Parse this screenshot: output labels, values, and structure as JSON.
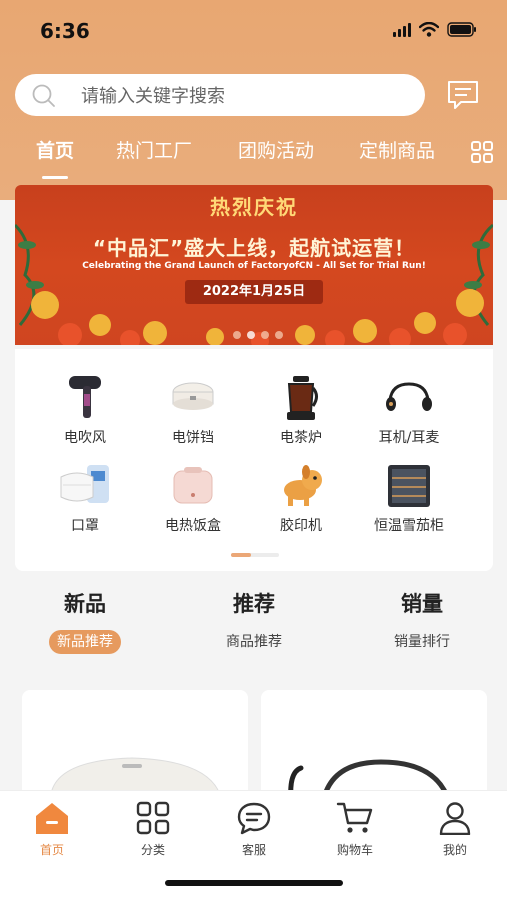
{
  "status": {
    "time": "6:36"
  },
  "search": {
    "placeholder": "请输入关键字搜索"
  },
  "tabs": [
    {
      "label": "首页",
      "active": true
    },
    {
      "label": "热门工厂"
    },
    {
      "label": "团购活动"
    },
    {
      "label": "定制商品"
    }
  ],
  "banner": {
    "title": "热烈庆祝",
    "headline": "“中品汇”盛大上线，起航试运营！",
    "subtitle": "Celebrating the Grand Launch of FactoryofCN - All Set for Trial Run!",
    "date": "2022年1月25日",
    "slide_count": 4,
    "active_slide": 1
  },
  "categories": [
    {
      "label": "电吹风",
      "icon": "hair-dryer-icon"
    },
    {
      "label": "电饼铛",
      "icon": "pancake-maker-icon"
    },
    {
      "label": "电茶炉",
      "icon": "tea-kettle-icon"
    },
    {
      "label": "耳机/耳麦",
      "icon": "headphones-icon"
    },
    {
      "label": "口罩",
      "icon": "face-mask-icon"
    },
    {
      "label": "电热饭盒",
      "icon": "lunch-box-icon"
    },
    {
      "label": "胶印机",
      "icon": "dog-toy-icon"
    },
    {
      "label": "恒温雪茄柜",
      "icon": "cigar-cabinet-icon"
    }
  ],
  "features": [
    {
      "title": "新品",
      "subtitle": "新品推荐",
      "active": true
    },
    {
      "title": "推荐",
      "subtitle": "商品推荐"
    },
    {
      "title": "销量",
      "subtitle": "销量排行"
    }
  ],
  "bottom_nav": [
    {
      "label": "首页",
      "icon": "home-icon",
      "active": true
    },
    {
      "label": "分类",
      "icon": "category-grid-icon"
    },
    {
      "label": "客服",
      "icon": "chat-bubble-icon"
    },
    {
      "label": "购物车",
      "icon": "cart-icon"
    },
    {
      "label": "我的",
      "icon": "user-icon"
    }
  ],
  "colors": {
    "accent": "#E58A47",
    "header": "#E9AB79",
    "banner": "#D4481F"
  }
}
